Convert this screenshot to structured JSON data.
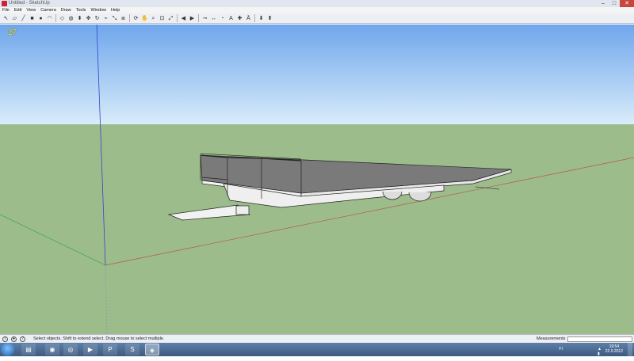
{
  "window": {
    "title": "Untitled - SketchUp"
  },
  "menu": [
    "File",
    "Edit",
    "View",
    "Camera",
    "Draw",
    "Tools",
    "Window",
    "Help"
  ],
  "toolbar": {
    "icons": [
      "select-icon",
      "eraser-icon",
      "line-icon",
      "rectangle-icon",
      "circle-icon",
      "arc-icon",
      "sep",
      "make-component-icon",
      "paint-bucket-icon",
      "push-pull-icon",
      "move-icon",
      "rotate-icon",
      "follow-me-icon",
      "scale-icon",
      "offset-icon",
      "sep",
      "orbit-icon",
      "pan-icon",
      "zoom-icon",
      "zoom-window-icon",
      "zoom-extents-icon",
      "sep",
      "previous-view-icon",
      "next-view-icon",
      "sep",
      "tape-measure-icon",
      "dimension-icon",
      "protractor-icon",
      "text-icon",
      "axes-icon",
      "3d-text-icon",
      "sep",
      "get-models-icon",
      "share-model-icon"
    ]
  },
  "viewport": {
    "overlay_value": "27",
    "sky_top": "#6fa6ec",
    "sky_bottom": "#d9ecfa",
    "ground": "#9dbc8b"
  },
  "status": {
    "hint": "Select objects. Shift to extend select. Drag mouse to select multiple.",
    "measurements_label": "Measurements",
    "measurements_value": ""
  },
  "taskbar": {
    "apps": [
      "explorer-icon",
      "steam-icon",
      "chrome-icon",
      "media-player-icon",
      "powerpoint-icon",
      "skype-icon",
      "sketchup-icon"
    ],
    "lang": "FI",
    "time": "19:54",
    "date": "22.9.2012"
  }
}
